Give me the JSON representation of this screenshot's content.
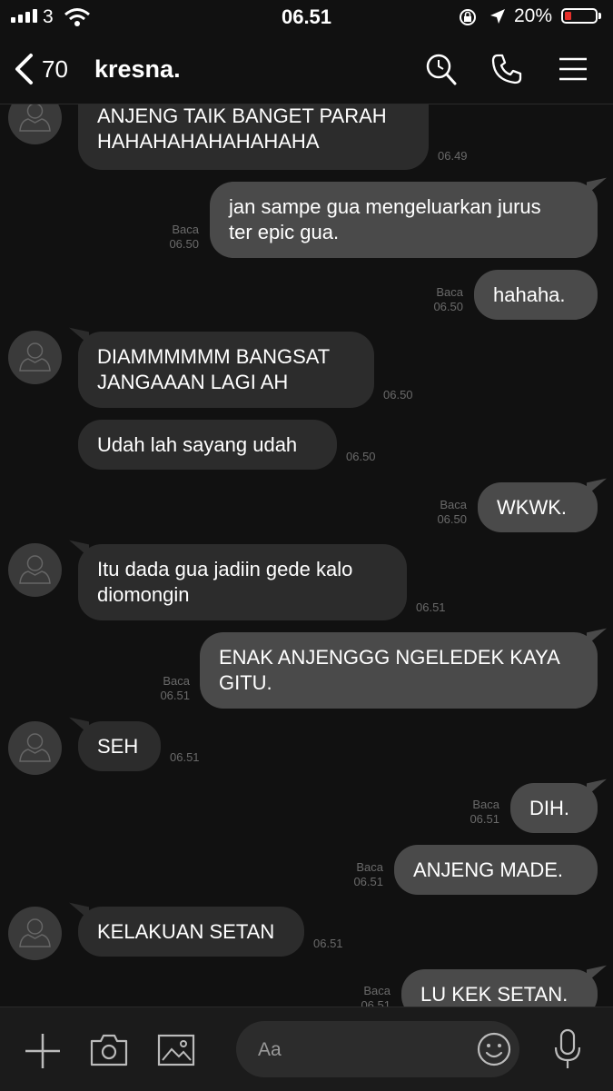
{
  "status": {
    "carrier": "3",
    "time": "06.51",
    "battery": "20%"
  },
  "header": {
    "back_count": "70",
    "title": "kresna."
  },
  "messages": [
    {
      "text": "ANJENG TAIK BANGET PARAH\nHAHAHAHAHAHAHAHA",
      "time": "06.49"
    },
    {
      "text": "jan sampe gua mengeluarkan jurus\nter epic gua.",
      "read": "Baca",
      "time": "06.50"
    },
    {
      "text": "hahaha.",
      "read": "Baca",
      "time": "06.50"
    },
    {
      "text": "DIAMMMMMM BANGSAT\nJANGAAAN LAGI AH",
      "time": "06.50"
    },
    {
      "text": "Udah lah sayang udah",
      "time": "06.50"
    },
    {
      "text": "WKWK.",
      "read": "Baca",
      "time": "06.50"
    },
    {
      "text": "Itu dada gua jadiin gede kalo\ndiomongin",
      "time": "06.51"
    },
    {
      "text": "ENAK ANJENGGG NGELEDEK KAYA\nGITU.",
      "read": "Baca",
      "time": "06.51"
    },
    {
      "text": "SEH",
      "time": "06.51"
    },
    {
      "text": "DIH.",
      "read": "Baca",
      "time": "06.51"
    },
    {
      "text": "ANJENG MADE.",
      "read": "Baca",
      "time": "06.51"
    },
    {
      "text": "KELAKUAN SETAN",
      "time": "06.51"
    },
    {
      "text": "LU KEK SETAN.",
      "read": "Baca",
      "time": "06.51"
    }
  ],
  "input": {
    "placeholder": "Aa"
  },
  "colors": {
    "incoming": "#2c2c2c",
    "outgoing": "#4a4a4a",
    "background": "#111111",
    "battery_low": "#e5302b"
  }
}
